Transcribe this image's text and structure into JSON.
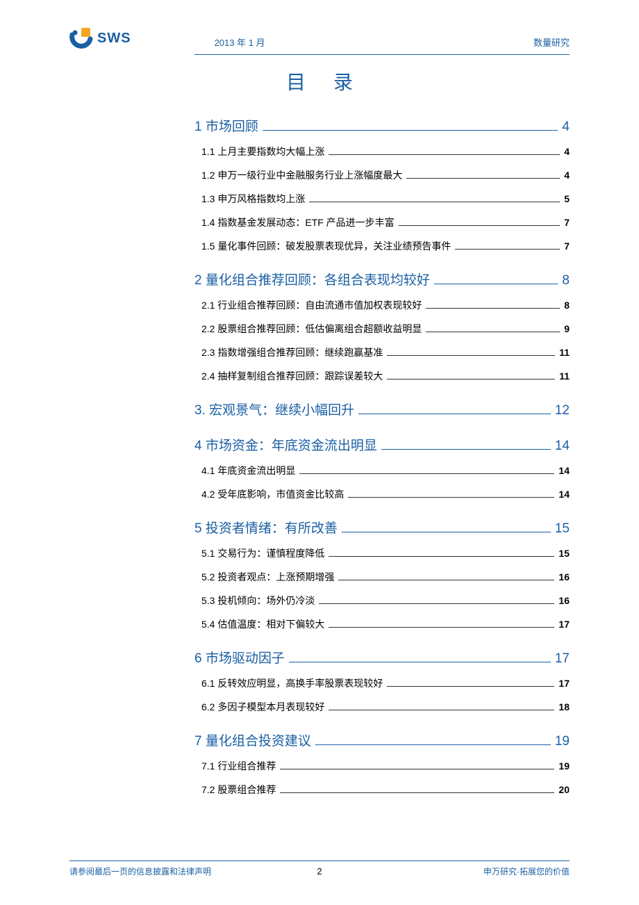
{
  "header": {
    "logo_text": "SWS",
    "date": "2013 年 1 月",
    "category": "数量研究"
  },
  "title": "目录",
  "toc": [
    {
      "num": "1",
      "label": "市场回顾",
      "page": "4",
      "subs": [
        {
          "num": "1.1",
          "label": "上月主要指数均大幅上涨",
          "page": "4"
        },
        {
          "num": "1.2",
          "label": "申万一级行业中金融服务行业上涨幅度最大",
          "page": "4"
        },
        {
          "num": "1.3",
          "label": "申万风格指数均上涨",
          "page": "5"
        },
        {
          "num": "1.4",
          "label": "指数基金发展动态：ETF 产品进一步丰富",
          "page": "7"
        },
        {
          "num": "1.5",
          "label": "量化事件回顾：破发股票表现优异，关注业绩预告事件",
          "page": "7"
        }
      ]
    },
    {
      "num": "2",
      "label": "量化组合推荐回顾：各组合表现均较好",
      "page": "8",
      "subs": [
        {
          "num": "2.1",
          "label": "行业组合推荐回顾：自由流通市值加权表现较好",
          "page": "8"
        },
        {
          "num": "2.2",
          "label": "股票组合推荐回顾：低估偏离组合超额收益明显",
          "page": "9"
        },
        {
          "num": "2.3",
          "label": "指数增强组合推荐回顾：继续跑赢基准",
          "page": "11"
        },
        {
          "num": "2.4",
          "label": "抽样复制组合推荐回顾：跟踪误差较大",
          "page": "11"
        }
      ]
    },
    {
      "num": "3.",
      "label": "宏观景气：继续小幅回升",
      "page": "12",
      "subs": []
    },
    {
      "num": "4",
      "label": "市场资金：年底资金流出明显",
      "page": "14",
      "subs": [
        {
          "num": "4.1",
          "label": "年底资金流出明显",
          "page": "14"
        },
        {
          "num": "4.2",
          "label": "受年底影响，市值资金比较高",
          "page": "14"
        }
      ]
    },
    {
      "num": "5",
      "label": "投资者情绪：有所改善",
      "page": "15",
      "subs": [
        {
          "num": "5.1",
          "label": "交易行为：谨慎程度降低",
          "page": "15"
        },
        {
          "num": "5.2",
          "label": "投资者观点：上涨预期增强",
          "page": "16"
        },
        {
          "num": "5.3",
          "label": "投机倾向：场外仍冷淡",
          "page": "16"
        },
        {
          "num": "5.4",
          "label": "估值温度：相对下偏较大",
          "page": "17"
        }
      ]
    },
    {
      "num": "6",
      "label": "市场驱动因子",
      "page": "17",
      "subs": [
        {
          "num": "6.1",
          "label": "反转效应明显，高换手率股票表现较好",
          "page": "17"
        },
        {
          "num": "6.2",
          "label": "多因子模型本月表现较好",
          "page": "18"
        }
      ]
    },
    {
      "num": "7",
      "label": "量化组合投资建议",
      "page": "19",
      "subs": [
        {
          "num": "7.1",
          "label": "行业组合推荐",
          "page": "19"
        },
        {
          "num": "7.2",
          "label": "股票组合推荐",
          "page": "20"
        }
      ]
    }
  ],
  "footer": {
    "left": "请参阅最后一页的信息披露和法律声明",
    "center": "2",
    "right": "申万研究·拓展您的价值"
  }
}
